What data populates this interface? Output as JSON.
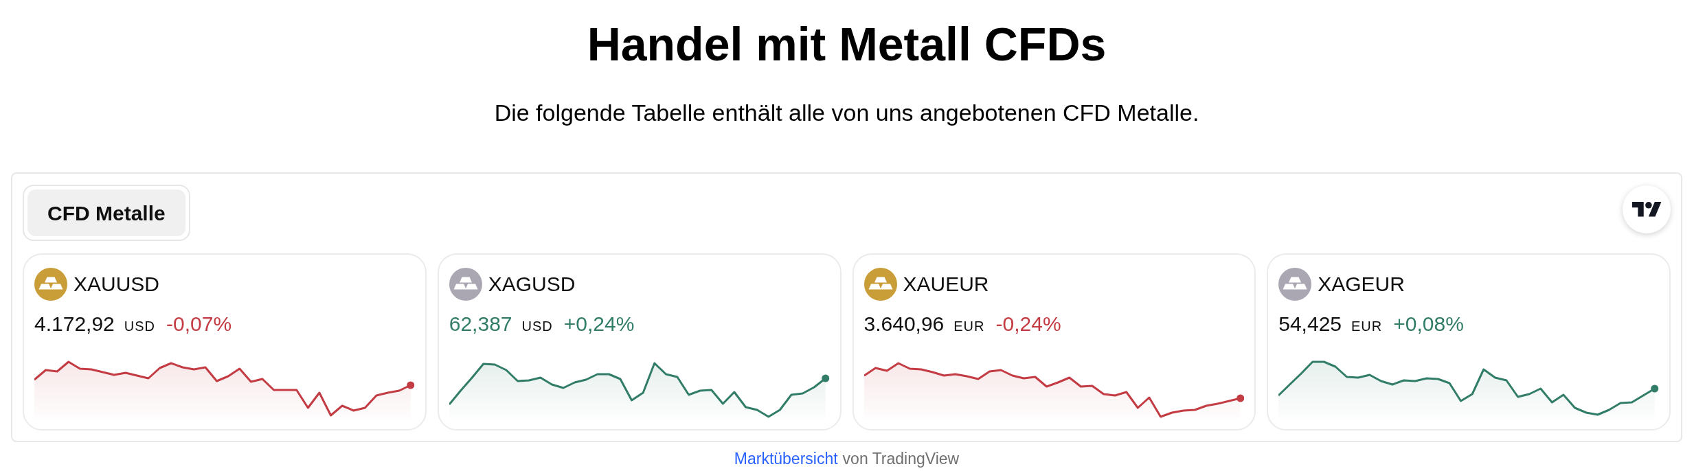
{
  "header": {
    "title": "Handel mit Metall CFDs",
    "subtitle": "Die folgende Tabelle enthält alle von uns angebotenen CFD Metalle."
  },
  "widget": {
    "tabs": [
      {
        "label": "CFD Metalle",
        "selected": true
      }
    ],
    "symbols": [
      {
        "symbol": "XAUUSD",
        "color": "#c99d38",
        "price": "4.172,92",
        "price_highlighted": false,
        "currency": "USD",
        "change": "-0,07%",
        "rising": false
      },
      {
        "symbol": "XAGUSD",
        "color": "#aaa7b3",
        "price": "62,387",
        "price_highlighted": true,
        "currency": "USD",
        "change": "+0,24%",
        "rising": true
      },
      {
        "symbol": "XAUEUR",
        "color": "#c99d38",
        "price": "3.640,96",
        "price_highlighted": false,
        "currency": "EUR",
        "change": "-0,24%",
        "rising": false
      },
      {
        "symbol": "XAGEUR",
        "color": "#aaa7b3",
        "price": "54,425",
        "price_highlighted": false,
        "currency": "EUR",
        "change": "+0,08%",
        "rising": true
      }
    ]
  },
  "footer": {
    "link": "Marktübersicht",
    "text": "von TradingView"
  }
}
